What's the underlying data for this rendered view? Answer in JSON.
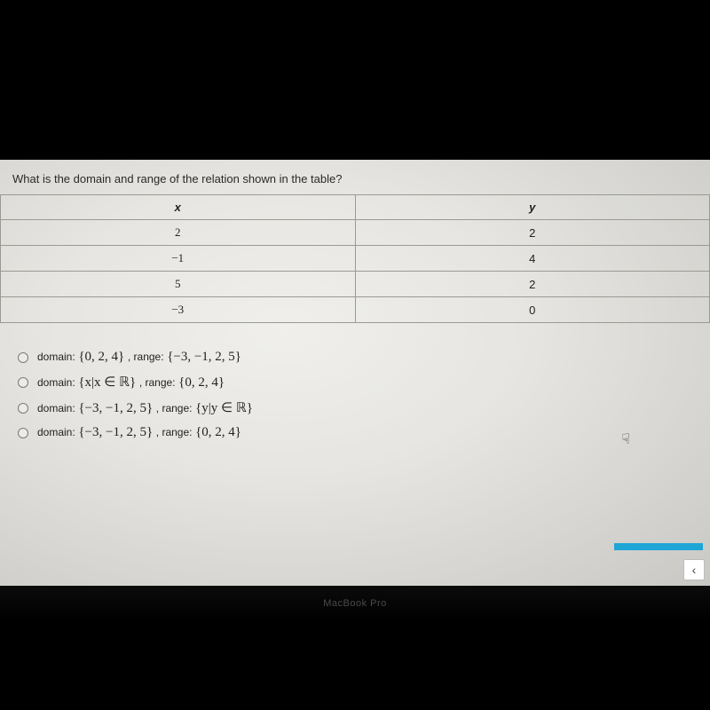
{
  "question": "What is the domain and range of the relation shown in the table?",
  "table": {
    "headers": {
      "x": "x",
      "y": "y"
    },
    "rows": [
      {
        "x": "2",
        "y": "2"
      },
      {
        "x": "−1",
        "y": "4"
      },
      {
        "x": "5",
        "y": "2"
      },
      {
        "x": "−3",
        "y": "0"
      }
    ]
  },
  "options": [
    {
      "domain_label": "domain:",
      "domain_set": "{0, 2, 4}",
      "range_label": ", range:",
      "range_set": "{−3, −1, 2, 5}"
    },
    {
      "domain_label": "domain:",
      "domain_set": "{x|x ∈ ℝ}",
      "range_label": ", range:",
      "range_set": "{0, 2, 4}"
    },
    {
      "domain_label": "domain:",
      "domain_set": "{−3, −1, 2, 5}",
      "range_label": ", range:",
      "range_set": "{y|y ∈ ℝ}"
    },
    {
      "domain_label": "domain:",
      "domain_set": "{−3, −1, 2, 5}",
      "range_label": ", range:",
      "range_set": "{0, 2, 4}"
    }
  ],
  "nav": {
    "prev_glyph": "‹"
  },
  "device": {
    "label": "MacBook Pro"
  },
  "cursor_glyph": "☟"
}
